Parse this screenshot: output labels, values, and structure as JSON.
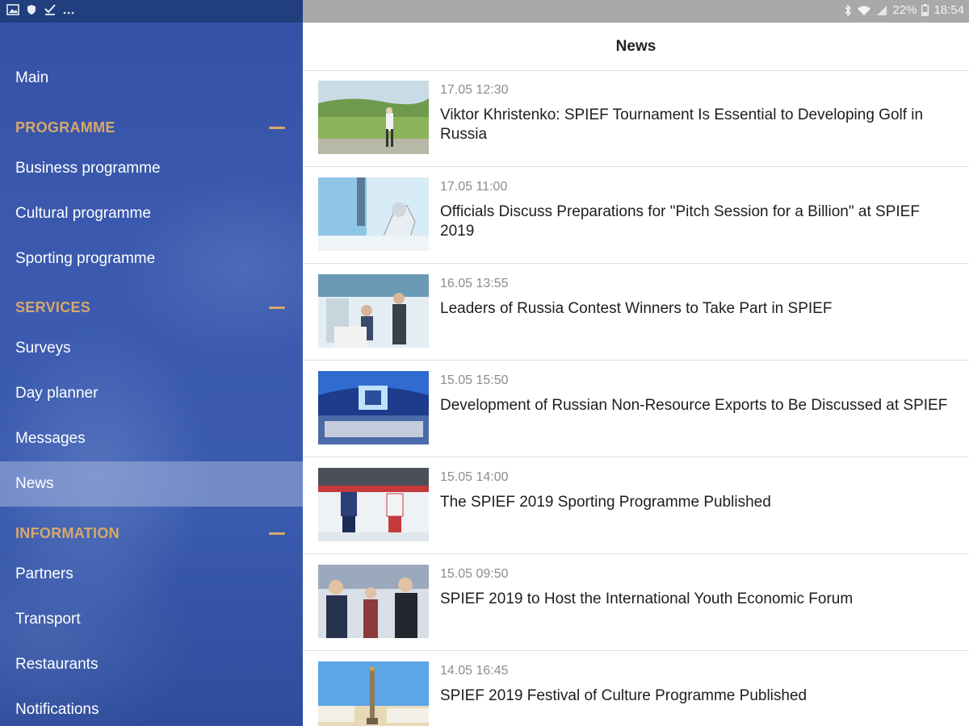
{
  "status_bar": {
    "battery": "22%",
    "time": "18:54",
    "left_icons": [
      "gallery-icon",
      "shield-icon",
      "check-icon",
      "more-icon"
    ],
    "right_icons": [
      "bluetooth-icon",
      "wifi-icon",
      "signal-icon",
      "battery-icon"
    ]
  },
  "sidebar": {
    "main_label": "Main",
    "sections": [
      {
        "title": "PROGRAMME",
        "items": [
          "Business programme",
          "Cultural programme",
          "Sporting programme"
        ]
      },
      {
        "title": "SERVICES",
        "items": [
          "Surveys",
          "Day planner",
          "Messages",
          "News"
        ]
      },
      {
        "title": "INFORMATION",
        "items": [
          "Partners",
          "Transport",
          "Restaurants",
          "Notifications"
        ]
      }
    ],
    "active_item": "News",
    "accent_color": "#d7a86a"
  },
  "header": {
    "title": "News"
  },
  "news": [
    {
      "date": "17.05 12:30",
      "title": "Viktor Khristenko: SPIEF Tournament Is Essential to Developing Golf in Russia",
      "image": "golf-photo"
    },
    {
      "date": "17.05 11:00",
      "title": "Officials Discuss Preparations for \"Pitch Session for a Billion\" at SPIEF 2019",
      "image": "robot-arm-photo"
    },
    {
      "date": "16.05 13:55",
      "title": "Leaders of Russia Contest Winners to Take Part in SPIEF",
      "image": "exhibition-photo"
    },
    {
      "date": "15.05 15:50",
      "title": "Development of Russian Non-Resource Exports to Be Discussed at SPIEF",
      "image": "stage-photo"
    },
    {
      "date": "15.05 14:00",
      "title": "The SPIEF 2019 Sporting Programme Published",
      "image": "hockey-photo"
    },
    {
      "date": "15.05 09:50",
      "title": "SPIEF 2019 to Host the International Youth Economic Forum",
      "image": "people-photo"
    },
    {
      "date": "14.05 16:45",
      "title": "SPIEF 2019 Festival of Culture Programme Published",
      "image": "city-square-photo"
    }
  ]
}
